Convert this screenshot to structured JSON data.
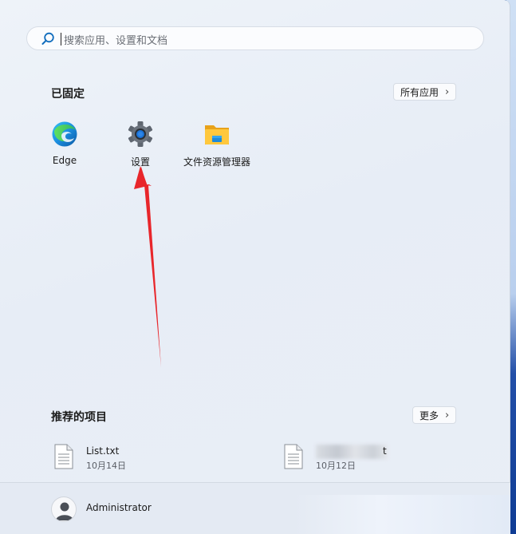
{
  "search": {
    "placeholder": "搜索应用、设置和文档"
  },
  "pinned": {
    "title": "已固定",
    "all_apps_label": "所有应用",
    "apps": [
      {
        "label": "Edge",
        "icon": "edge-icon"
      },
      {
        "label": "设置",
        "icon": "gear-icon"
      },
      {
        "label": "文件资源管理器",
        "icon": "folder-icon"
      }
    ]
  },
  "recommended": {
    "title": "推荐的项目",
    "more_label": "更多",
    "items": [
      {
        "name": "List.txt",
        "date": "10月14日",
        "icon": "text-file-icon"
      },
      {
        "name": "t",
        "date": "10月12日",
        "icon": "text-file-icon"
      }
    ]
  },
  "user": {
    "name": "Administrator"
  },
  "annotation": {
    "arrow_color": "#e8262b"
  }
}
